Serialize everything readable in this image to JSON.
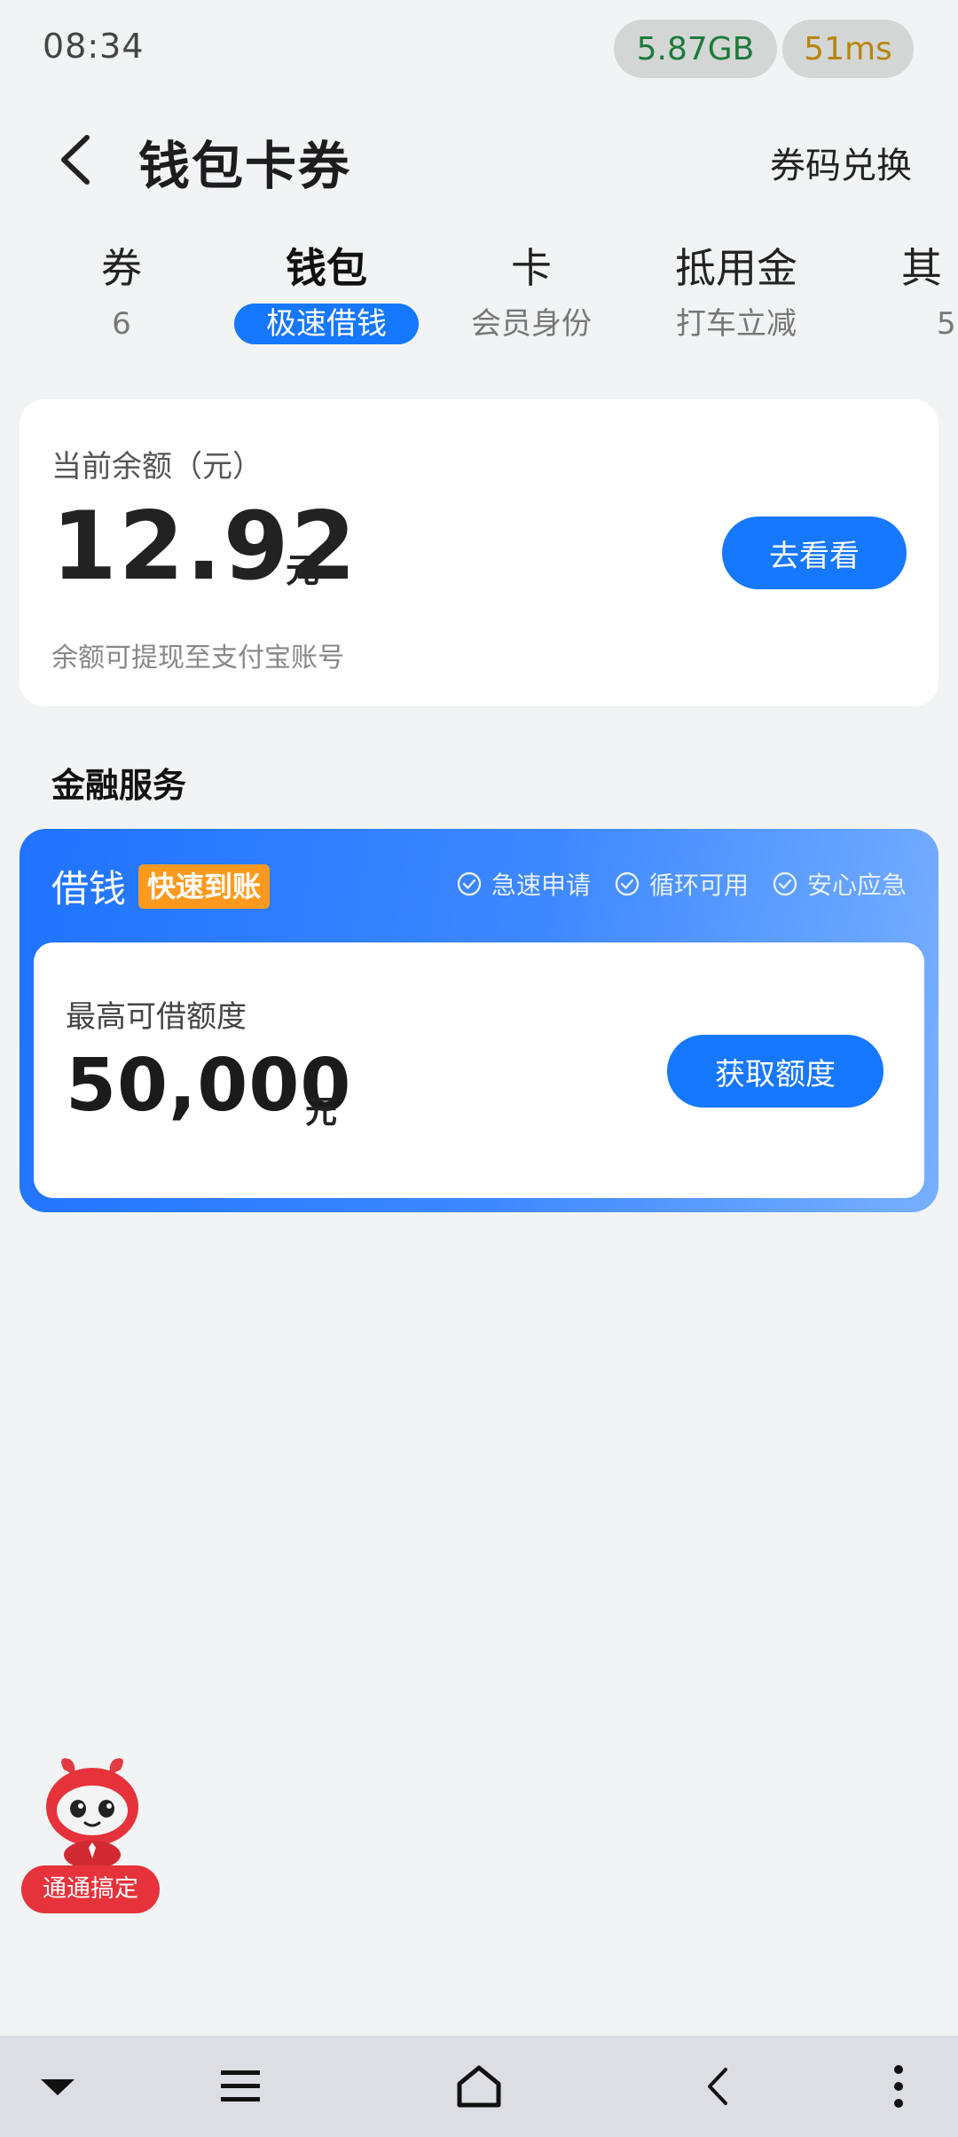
{
  "status_bar": {
    "time": "08:34",
    "data_usage": "5.87GB",
    "ping": "51ms"
  },
  "header": {
    "title": "钱包卡券",
    "redeem_label": "券码兑换"
  },
  "tabs": [
    {
      "title": "券",
      "sub": "6"
    },
    {
      "title": "钱包",
      "sub": "极速借钱",
      "active": true
    },
    {
      "title": "卡",
      "sub": "会员身份"
    },
    {
      "title": "抵用金",
      "sub": "打车立减"
    },
    {
      "title": "其",
      "sub": "5"
    }
  ],
  "balance": {
    "label": "当前余额（元）",
    "amount": "12.92",
    "unit": "元",
    "button_label": "去看看",
    "note": "余额可提现至支付宝账号"
  },
  "section": {
    "title": "金融服务"
  },
  "loan": {
    "title": "借钱",
    "tag": "快速到账",
    "features": [
      "急速申请",
      "循环可用",
      "安心应急"
    ],
    "limit_label": "最高可借额度",
    "limit_amount": "50,000",
    "limit_unit": "元",
    "button_label": "获取额度"
  },
  "mascot": {
    "label": "通通搞定"
  },
  "colors": {
    "accent": "#1677ff",
    "tag": "#ff9a1f",
    "mascot": "#e6323a"
  },
  "icons": {
    "back": "chevron-left-icon",
    "check": "check-circle-icon",
    "nav": [
      "chevron-down-icon",
      "menu-icon",
      "home-icon",
      "back-arrow-icon",
      "more-vertical-icon"
    ]
  }
}
